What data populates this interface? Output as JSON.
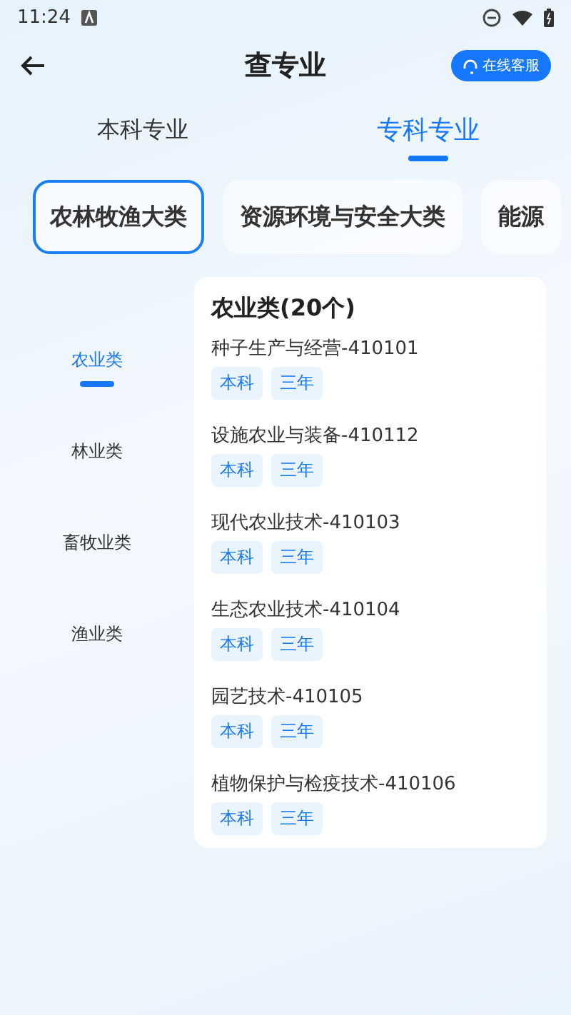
{
  "status_bar": {
    "time": "11:24"
  },
  "header": {
    "title": "查专业",
    "service_button": "在线客服"
  },
  "tabs": [
    {
      "label": "本科专业",
      "selected": false
    },
    {
      "label": "专科专业",
      "selected": true
    }
  ],
  "categories": [
    {
      "label": "农林牧渔大类",
      "selected": true
    },
    {
      "label": "资源环境与安全大类",
      "selected": false
    },
    {
      "label": "能源",
      "selected": false
    }
  ],
  "subcategories": [
    {
      "label": "农业类",
      "selected": true
    },
    {
      "label": "林业类",
      "selected": false
    },
    {
      "label": "畜牧业类",
      "selected": false
    },
    {
      "label": "渔业类",
      "selected": false
    }
  ],
  "list": {
    "title": "农业类(20个)",
    "majors": [
      {
        "name": "种子生产与经营-410101",
        "tags": [
          "本科",
          "三年"
        ]
      },
      {
        "name": "设施农业与装备-410112",
        "tags": [
          "本科",
          "三年"
        ]
      },
      {
        "name": "现代农业技术-410103",
        "tags": [
          "本科",
          "三年"
        ]
      },
      {
        "name": "生态农业技术-410104",
        "tags": [
          "本科",
          "三年"
        ]
      },
      {
        "name": "园艺技术-410105",
        "tags": [
          "本科",
          "三年"
        ]
      },
      {
        "name": "植物保护与检疫技术-410106",
        "tags": [
          "本科",
          "三年"
        ]
      }
    ]
  }
}
